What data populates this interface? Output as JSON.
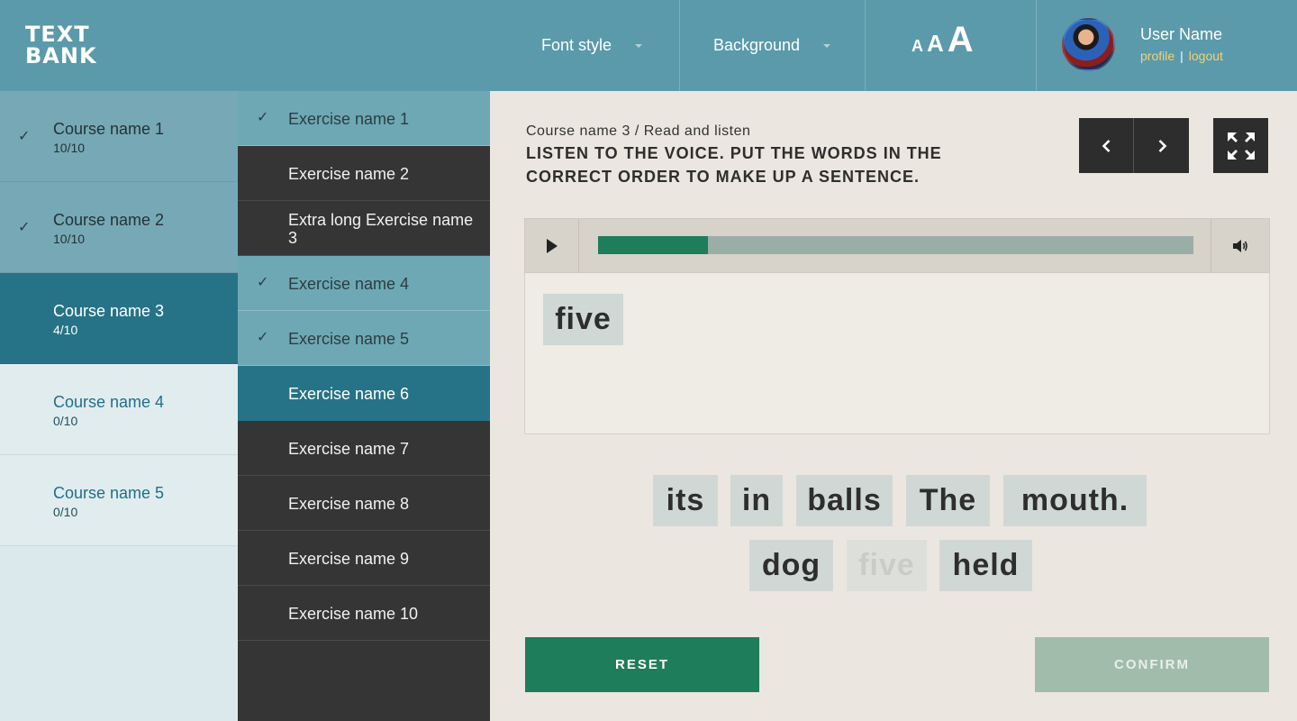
{
  "header": {
    "logo_line1": "TEXT",
    "logo_line2": "BANK",
    "font_style_label": "Font style",
    "background_label": "Background",
    "font_size_small": "A",
    "font_size_medium": "A",
    "font_size_large": "A",
    "user_name": "User Name",
    "profile_link": "profile",
    "separator": "|",
    "logout_link": "logout"
  },
  "courses": [
    {
      "name": "Course name 1",
      "progress": "10/10",
      "state": "done"
    },
    {
      "name": "Course name 2",
      "progress": "10/10",
      "state": "done"
    },
    {
      "name": "Course name 3",
      "progress": "4/10",
      "state": "active"
    },
    {
      "name": "Course name 4",
      "progress": "0/10",
      "state": "todo"
    },
    {
      "name": "Course name 5",
      "progress": "0/10",
      "state": "todo"
    }
  ],
  "exercises": [
    {
      "name": "Exercise name 1",
      "state": "done"
    },
    {
      "name": "Exercise name 2",
      "state": "todo"
    },
    {
      "name": "Extra long Exercise name 3",
      "state": "todo"
    },
    {
      "name": "Exercise name 4",
      "state": "done"
    },
    {
      "name": "Exercise name 5",
      "state": "done"
    },
    {
      "name": "Exercise name 6",
      "state": "active"
    },
    {
      "name": "Exercise name 7",
      "state": "todo"
    },
    {
      "name": "Exercise name 8",
      "state": "todo"
    },
    {
      "name": "Exercise name 9",
      "state": "todo"
    },
    {
      "name": "Exercise name 10",
      "state": "todo"
    }
  ],
  "main": {
    "breadcrumb": "Course name 3 / Read and listen",
    "instruction": "LISTEN TO THE VOICE. PUT THE WORDS IN THE CORRECT ORDER TO MAKE UP A SENTENCE.",
    "audio_progress": 0.184,
    "answer_words": [
      "five"
    ],
    "word_bank": [
      {
        "word": "its",
        "used": false
      },
      {
        "word": "in",
        "used": false
      },
      {
        "word": "balls",
        "used": false
      },
      {
        "word": "The",
        "used": false
      },
      {
        "word": "mouth.",
        "used": false
      },
      {
        "word": "dog",
        "used": false
      },
      {
        "word": "five",
        "used": true
      },
      {
        "word": "held",
        "used": false
      }
    ],
    "reset_label": "RESET",
    "confirm_label": "CONFIRM"
  },
  "icons": {
    "check": "check-icon",
    "prev": "chevron-left-icon",
    "next": "chevron-right-icon",
    "fullscreen": "expand-icon",
    "play": "play-icon",
    "volume": "volume-icon"
  },
  "colors": {
    "header": "#5a9aab",
    "active": "#267387",
    "green": "#1e7d5b",
    "dark": "#353535"
  }
}
